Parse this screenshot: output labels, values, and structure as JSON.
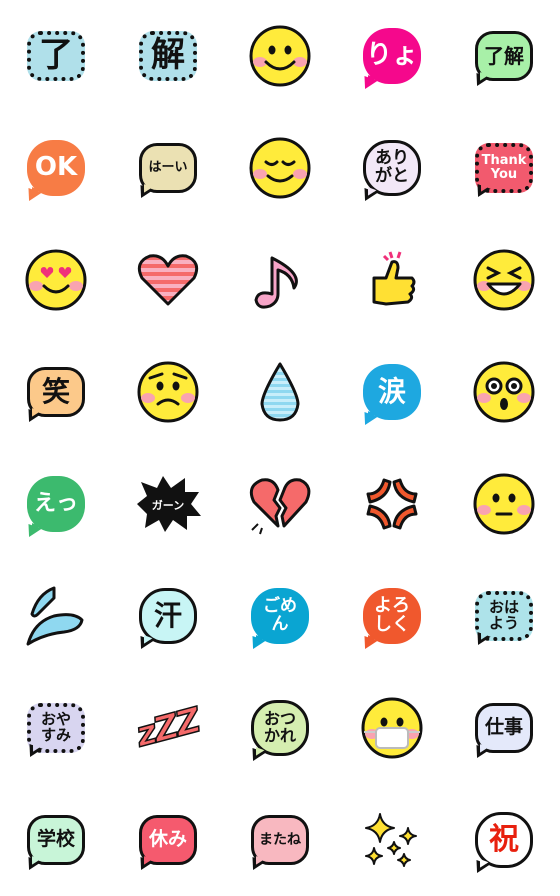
{
  "items": [
    {
      "name": "sticker-ryo",
      "kind": "bubble",
      "shape": "cloud",
      "text": "了",
      "bg": "#b0e0ea",
      "fg": "#111",
      "size": 34
    },
    {
      "name": "sticker-kai",
      "kind": "bubble",
      "shape": "cloud",
      "text": "解",
      "bg": "#b0e0ea",
      "fg": "#111",
      "size": 34
    },
    {
      "name": "smile-face",
      "kind": "face",
      "face": "smile"
    },
    {
      "name": "sticker-ryo-pink",
      "kind": "bubble",
      "shape": "round",
      "text": "りょ",
      "bg": "#f5088c",
      "fg": "#fff",
      "size": 26,
      "noborder": true,
      "tail": true
    },
    {
      "name": "sticker-ryokai",
      "kind": "bubble",
      "shape": "rect",
      "text": "了解",
      "bg": "#a8f0a8",
      "fg": "#111",
      "size": 20,
      "tail": true
    },
    {
      "name": "sticker-ok",
      "kind": "bubble",
      "shape": "round",
      "text": "OK",
      "bg": "#f77c45",
      "fg": "#fff",
      "size": 26,
      "noborder": true,
      "tail": true
    },
    {
      "name": "sticker-haai",
      "kind": "bubble",
      "shape": "rect",
      "text": "はーい",
      "bg": "#ebe1b3",
      "fg": "#111",
      "size": 13,
      "tail": true
    },
    {
      "name": "content-face",
      "kind": "face",
      "face": "content"
    },
    {
      "name": "sticker-arigato",
      "kind": "bubble",
      "shape": "round",
      "text": "あり\nがと",
      "bg": "#f2e8f7",
      "fg": "#111",
      "size": 17,
      "tail": true
    },
    {
      "name": "sticker-thank-you",
      "kind": "bubble",
      "shape": "cloud",
      "text": "Thank\nYou",
      "bg": "#f25a6e",
      "fg": "#fff",
      "size": 13,
      "tail": true
    },
    {
      "name": "heart-eyes-face",
      "kind": "face",
      "face": "hearteyes"
    },
    {
      "name": "striped-heart-icon",
      "kind": "icon",
      "icon": "heart"
    },
    {
      "name": "music-note-icon",
      "kind": "icon",
      "icon": "note"
    },
    {
      "name": "thumbs-up-icon",
      "kind": "icon",
      "icon": "thumb"
    },
    {
      "name": "laughing-face",
      "kind": "face",
      "face": "laugh"
    },
    {
      "name": "sticker-warai",
      "kind": "bubble",
      "shape": "rect",
      "text": "笑",
      "bg": "#fcc98a",
      "fg": "#111",
      "size": 28,
      "tail": true
    },
    {
      "name": "worried-face",
      "kind": "face",
      "face": "worried"
    },
    {
      "name": "water-drop-icon",
      "kind": "icon",
      "icon": "drop"
    },
    {
      "name": "sticker-namida",
      "kind": "bubble",
      "shape": "round",
      "text": "涙",
      "bg": "#1ea8e0",
      "fg": "#fff",
      "size": 28,
      "noborder": true,
      "tail": true
    },
    {
      "name": "surprised-face",
      "kind": "face",
      "face": "surprised"
    },
    {
      "name": "sticker-e",
      "kind": "bubble",
      "shape": "round",
      "text": "えっ",
      "bg": "#3cba6e",
      "fg": "#fff",
      "size": 22,
      "noborder": true,
      "tail": true
    },
    {
      "name": "sticker-gaan",
      "kind": "icon",
      "icon": "burst",
      "text": "ガーン"
    },
    {
      "name": "broken-heart-icon",
      "kind": "icon",
      "icon": "brokenheart"
    },
    {
      "name": "anger-icon",
      "kind": "icon",
      "icon": "anger"
    },
    {
      "name": "neutral-face",
      "kind": "face",
      "face": "neutral"
    },
    {
      "name": "sweat-drops-icon",
      "kind": "icon",
      "icon": "sweat"
    },
    {
      "name": "sticker-ase",
      "kind": "bubble",
      "shape": "round",
      "text": "汗",
      "bg": "#c8f5f5",
      "fg": "#111",
      "size": 28,
      "tail": true
    },
    {
      "name": "sticker-gomen",
      "kind": "bubble",
      "shape": "round",
      "text": "ごめ\nん",
      "bg": "#0aa5d2",
      "fg": "#fff",
      "size": 17,
      "noborder": true,
      "tail": true
    },
    {
      "name": "sticker-yoroshiku",
      "kind": "bubble",
      "shape": "round",
      "text": "よろ\nしく",
      "bg": "#f0582d",
      "fg": "#fff",
      "size": 18,
      "noborder": true,
      "tail": true
    },
    {
      "name": "sticker-ohayou",
      "kind": "bubble",
      "shape": "cloud",
      "text": "おは\nよう",
      "bg": "#aee3ea",
      "fg": "#111",
      "size": 15,
      "tail": true
    },
    {
      "name": "sticker-oyasumi",
      "kind": "bubble",
      "shape": "cloud",
      "text": "おや\nすみ",
      "bg": "#d8d5f0",
      "fg": "#111",
      "size": 15,
      "tail": true
    },
    {
      "name": "zzz-icon",
      "kind": "icon",
      "icon": "zzz",
      "text": "zZZ"
    },
    {
      "name": "sticker-otsukare",
      "kind": "bubble",
      "shape": "round",
      "text": "おつ\nかれ",
      "bg": "#d5eeb0",
      "fg": "#111",
      "size": 16,
      "tail": true
    },
    {
      "name": "mask-face",
      "kind": "face",
      "face": "mask"
    },
    {
      "name": "sticker-shigoto",
      "kind": "bubble",
      "shape": "rect",
      "text": "仕事",
      "bg": "#e4e9fa",
      "fg": "#111",
      "size": 19,
      "tail": true
    },
    {
      "name": "sticker-gakkou",
      "kind": "bubble",
      "shape": "rect",
      "text": "学校",
      "bg": "#c8f5d8",
      "fg": "#111",
      "size": 19,
      "tail": true
    },
    {
      "name": "sticker-yasumi",
      "kind": "bubble",
      "shape": "rect",
      "text": "休み",
      "bg": "#f55a6e",
      "fg": "#fff",
      "size": 19,
      "tail": true
    },
    {
      "name": "sticker-matane",
      "kind": "bubble",
      "shape": "rect",
      "text": "またね",
      "bg": "#f8b8c0",
      "fg": "#111",
      "size": 14,
      "tail": true
    },
    {
      "name": "sparkles-icon",
      "kind": "icon",
      "icon": "sparkles"
    },
    {
      "name": "sticker-iwai",
      "kind": "bubble",
      "shape": "round",
      "text": "祝",
      "bg": "#ffffff",
      "fg": "#e8200e",
      "size": 30,
      "tail": true
    }
  ],
  "colors": {
    "face": "#ffeb3b",
    "cheek": "#f9a3b0",
    "outline": "#111111"
  }
}
